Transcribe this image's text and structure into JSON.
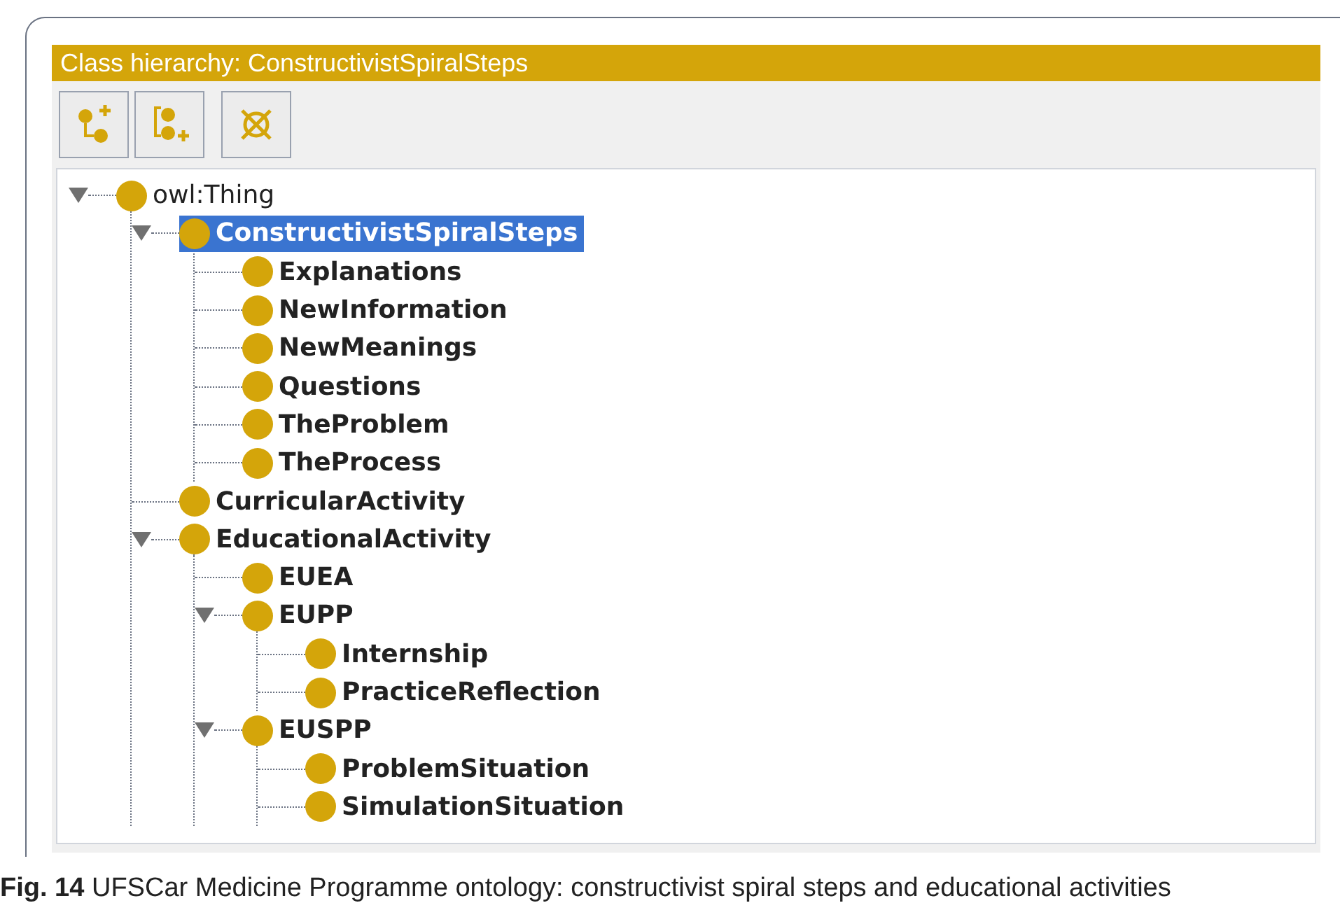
{
  "panel": {
    "title": "Class hierarchy: ConstructivistSpiralSteps"
  },
  "toolbar": [
    {
      "kind": "add-subclass"
    },
    {
      "kind": "add-sibling"
    },
    {
      "kind": "delete"
    }
  ],
  "tree": [
    {
      "label": "owl:Thing",
      "bold": false,
      "selected": false,
      "expanded": true,
      "children": [
        {
          "label": "ConstructivistSpiralSteps",
          "bold": true,
          "selected": true,
          "expanded": true,
          "children": [
            {
              "label": "Explanations",
              "bold": true,
              "selected": false
            },
            {
              "label": "NewInformation",
              "bold": true,
              "selected": false
            },
            {
              "label": "NewMeanings",
              "bold": true,
              "selected": false
            },
            {
              "label": "Questions",
              "bold": true,
              "selected": false
            },
            {
              "label": "TheProblem",
              "bold": true,
              "selected": false
            },
            {
              "label": "TheProcess",
              "bold": true,
              "selected": false
            }
          ]
        },
        {
          "label": "CurricularActivity",
          "bold": true,
          "selected": false
        },
        {
          "label": "EducationalActivity",
          "bold": true,
          "selected": false,
          "expanded": true,
          "children": [
            {
              "label": "EUEA",
              "bold": true,
              "selected": false
            },
            {
              "label": "EUPP",
              "bold": true,
              "selected": false,
              "expanded": true,
              "children": [
                {
                  "label": "Internship",
                  "bold": true,
                  "selected": false
                },
                {
                  "label": "PracticeReflection",
                  "bold": true,
                  "selected": false
                }
              ]
            },
            {
              "label": "EUSPP",
              "bold": true,
              "selected": false,
              "expanded": true,
              "children": [
                {
                  "label": "ProblemSituation",
                  "bold": true,
                  "selected": false
                },
                {
                  "label": "SimulationSituation",
                  "bold": true,
                  "selected": false
                }
              ]
            }
          ]
        }
      ]
    }
  ],
  "caption": "**Fig. 14** UFSCar Medicine Programme ontology: constructivist spiral steps and educational activities"
}
